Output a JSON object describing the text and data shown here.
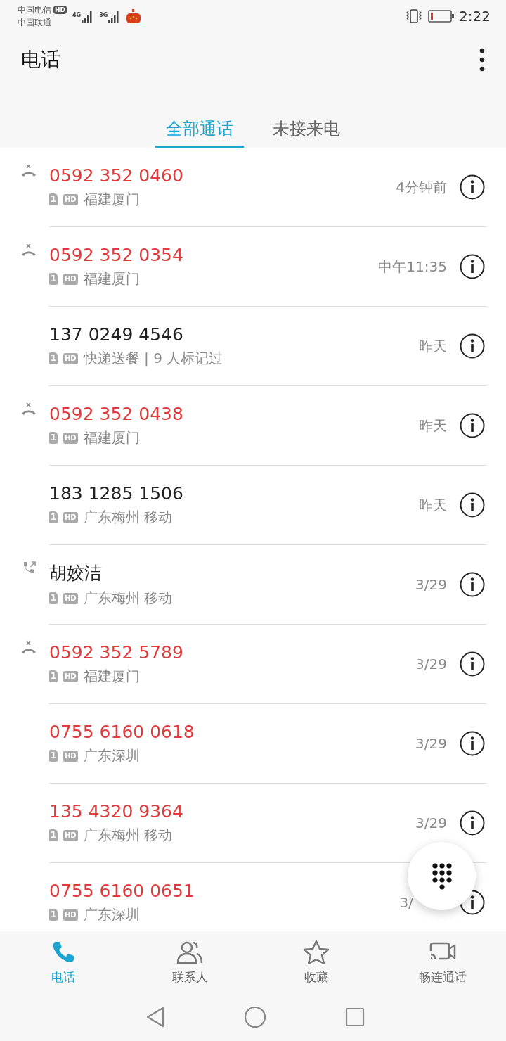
{
  "status_bar": {
    "carrier_1": "中国电信",
    "carrier_1_badge": "HD",
    "carrier_2": "中国联通",
    "network_1": "4G",
    "network_2": "3G",
    "time": "2:22"
  },
  "header": {
    "title": "电话"
  },
  "tabs": [
    {
      "label": "全部通话",
      "selected": true
    },
    {
      "label": "未接来电",
      "selected": false
    }
  ],
  "calls": [
    {
      "name": "0592 352 0460",
      "sim": "1",
      "quality": "HD",
      "location": "福建厦门",
      "time": "4分钟前",
      "missed": true,
      "kind": "missed"
    },
    {
      "name": "0592 352 0354",
      "sim": "1",
      "quality": "HD",
      "location": "福建厦门",
      "time": "中午11:35",
      "missed": true,
      "kind": "missed"
    },
    {
      "name": "137 0249 4546",
      "sim": "1",
      "quality": "HD",
      "location": "快递送餐 | 9 人标记过",
      "time": "昨天",
      "missed": false,
      "kind": "plain"
    },
    {
      "name": "0592 352 0438",
      "sim": "1",
      "quality": "HD",
      "location": "福建厦门",
      "time": "昨天",
      "missed": true,
      "kind": "missed"
    },
    {
      "name": "183 1285 1506",
      "sim": "1",
      "quality": "HD",
      "location": "广东梅州 移动",
      "time": "昨天",
      "missed": false,
      "kind": "plain"
    },
    {
      "name": "胡姣洁",
      "sim": "1",
      "quality": "HD",
      "location": "广东梅州 移动",
      "time": "3/29",
      "missed": false,
      "kind": "outgoing"
    },
    {
      "name": "0592 352 5789",
      "sim": "1",
      "quality": "HD",
      "location": "福建厦门",
      "time": "3/29",
      "missed": true,
      "kind": "missed"
    },
    {
      "name": "0755 6160 0618",
      "sim": "1",
      "quality": "HD",
      "location": "广东深圳",
      "time": "3/29",
      "missed": true,
      "kind": "plain"
    },
    {
      "name": "135 4320 9364",
      "sim": "1",
      "quality": "HD",
      "location": "广东梅州 移动",
      "time": "3/29",
      "missed": true,
      "kind": "plain"
    },
    {
      "name": "0755 6160 0651",
      "sim": "1",
      "quality": "HD",
      "location": "广东深圳",
      "time": "3/",
      "missed": true,
      "kind": "plain"
    }
  ],
  "bottom_nav": [
    {
      "label": "电话",
      "kind": "phone",
      "selected": true
    },
    {
      "label": "联系人",
      "kind": "contacts",
      "selected": false
    },
    {
      "label": "收藏",
      "kind": "star",
      "selected": false
    },
    {
      "label": "畅连通话",
      "kind": "video",
      "selected": false
    }
  ]
}
